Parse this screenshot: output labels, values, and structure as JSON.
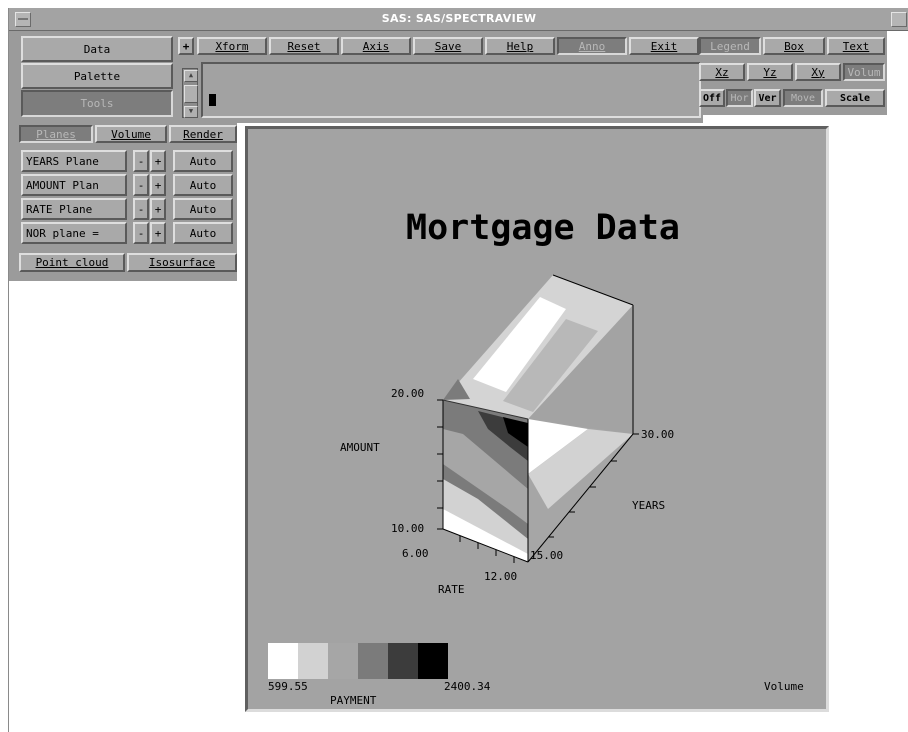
{
  "window": {
    "title": "SAS: SAS/SPECTRAVIEW"
  },
  "left_menu": [
    "Data",
    "Palette",
    "Tools"
  ],
  "toolbar": {
    "plus_label": "+",
    "buttons": [
      "Xform",
      "Reset",
      "Axis",
      "Save",
      "Help",
      "Anno",
      "Exit"
    ]
  },
  "right_toolbar": {
    "row1": [
      "Legend",
      "Box",
      "Text"
    ],
    "row2": [
      "Xz",
      "Yz",
      "Xy",
      "Volum"
    ],
    "row3": [
      "Off",
      "Hor",
      "Ver",
      "Move",
      "Scale"
    ]
  },
  "tabs": [
    "Planes",
    "Volume",
    "Render"
  ],
  "planes": [
    {
      "label": "YEARS Plane",
      "minus": "-",
      "plus": "+",
      "auto": "Auto"
    },
    {
      "label": "AMOUNT Plan",
      "minus": "-",
      "plus": "+",
      "auto": "Auto"
    },
    {
      "label": "RATE Plane",
      "minus": "-",
      "plus": "+",
      "auto": "Auto"
    },
    {
      "label": "NOR plane =",
      "minus": "-",
      "plus": "+",
      "auto": "Auto"
    }
  ],
  "bottom_buttons": [
    "Point cloud",
    "Isosurface"
  ],
  "plot": {
    "title": "Mortgage Data",
    "axes": {
      "amount": {
        "label": "AMOUNT",
        "max": "20.00",
        "min": "10.00"
      },
      "years": {
        "label": "YEARS",
        "max": "30.00",
        "min": "15.00"
      },
      "rate": {
        "label": "RATE",
        "min": "6.00",
        "max": "12.00"
      }
    },
    "legend": {
      "min": "599.55",
      "max": "2400.34",
      "label": "PAYMENT",
      "colors": [
        "#ffffff",
        "#d2d2d2",
        "#a6a6a6",
        "#7b7b7b",
        "#3c3c3c",
        "#000000"
      ]
    },
    "mode_label": "Volume"
  }
}
